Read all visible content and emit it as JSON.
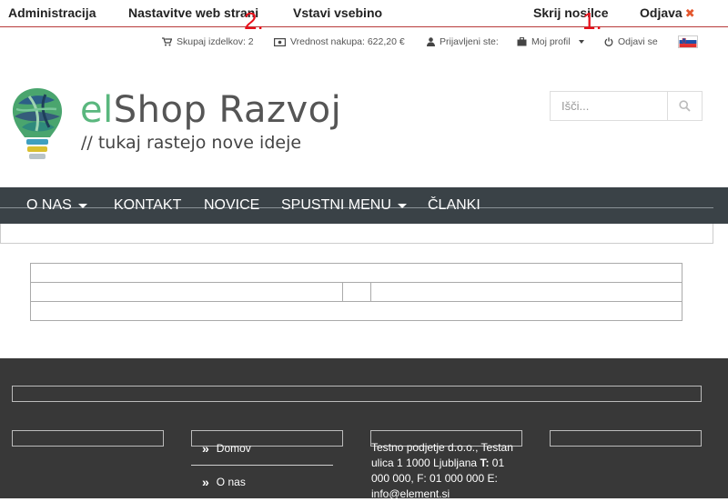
{
  "admin_bar": {
    "administracija": "Administracija",
    "nastavitve": "Nastavitve web strani",
    "vstavi": "Vstavi vsebino",
    "skrij": "Skrij nosilce",
    "odjava": "Odjava",
    "marker1": "1.",
    "marker2": "2."
  },
  "user_bar": {
    "cart_count": "Skupaj izdelkov: 2",
    "cart_value": "Vrednost nakupa: 622,20 €",
    "logged_in": "Prijavljeni ste:",
    "profile": "Moj profil",
    "logout": "Odjavi se"
  },
  "brand": {
    "prefix": "el",
    "name": "Shop Razvoj",
    "tagline": "// tukaj rastejo nove ideje"
  },
  "search": {
    "placeholder": "Išči..."
  },
  "nav": {
    "items": [
      {
        "label": "O NAS"
      },
      {
        "label": "KONTAKT"
      },
      {
        "label": "NOVICE"
      },
      {
        "label": "SPUSTNI MENU"
      },
      {
        "label": "ČLANKI"
      }
    ]
  },
  "footer": {
    "links": [
      {
        "label": "Domov"
      },
      {
        "label": "O nas"
      }
    ],
    "company": "Testno podjetje d.o.o., Testan ulica 1 1000 Ljubljana",
    "tel_label": "T:",
    "tel": "01 000 000,",
    "fax": "F: 01 000 000",
    "email_label": "E:",
    "email": "info@element.si"
  },
  "colors": {
    "nav_bg": "#3a4247",
    "footer_bg": "#383838",
    "brand_green": "#5ab77e",
    "marker_red": "#e8101a"
  }
}
